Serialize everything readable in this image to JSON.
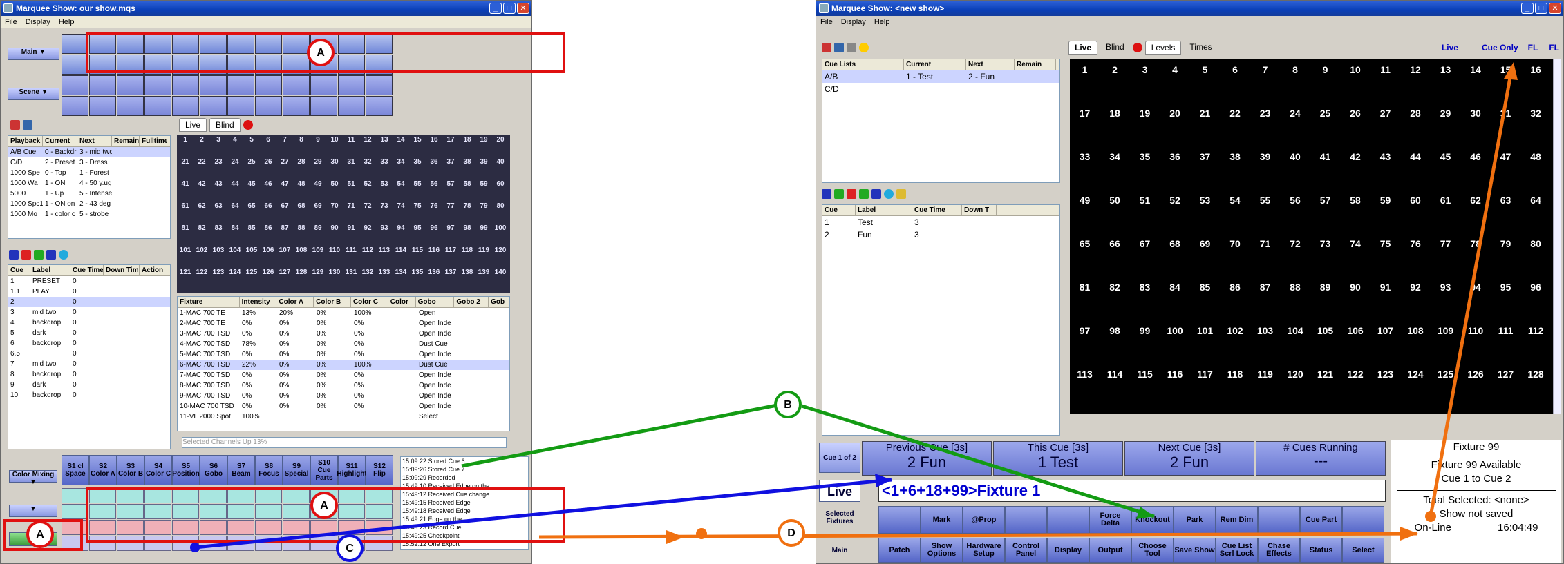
{
  "left": {
    "title": "Marquee Show: our show.mqs",
    "menu": [
      "File",
      "Display",
      "Help"
    ],
    "main_label": "Main",
    "scene_label": "Scene",
    "cue_lists_hdr": [
      "Playback",
      "Current",
      "Next",
      "Remain",
      "Fulltime"
    ],
    "cue_lists": [
      [
        "A/B Cue",
        "0 - Backdrop",
        "3 - mid two",
        "",
        ""
      ],
      [
        "C/D",
        "2 - Preset",
        "3 - Dress",
        "",
        ""
      ],
      [
        "1000 Spe",
        "0 - Top",
        "1 - Forest",
        "",
        ""
      ],
      [
        "1000 Wa",
        "1 - ON",
        "4 - 50 y.ug",
        "",
        ""
      ],
      [
        "5000",
        "1 - Up",
        "5 - Intense",
        "",
        ""
      ],
      [
        "1000 Spc1",
        "1 - ON on",
        "2 - 43 deg",
        "",
        ""
      ],
      [
        "1000 Mo",
        "1 - color c",
        "5 - strobe",
        "",
        ""
      ]
    ],
    "cues_hdr": [
      "Cue",
      "Label",
      "Cue Time",
      "Down Time",
      "Action"
    ],
    "cues": [
      [
        "1",
        "PRESET",
        "0"
      ],
      [
        "1.1",
        "PLAY",
        "0"
      ],
      [
        "2",
        "",
        "0"
      ],
      [
        "3",
        "mid two",
        "0"
      ],
      [
        "4",
        "backdrop",
        "0"
      ],
      [
        "5",
        "dark",
        "0"
      ],
      [
        "6",
        "backdrop",
        "0"
      ],
      [
        "6.5",
        "",
        "0"
      ],
      [
        "7",
        "mid two",
        "0"
      ],
      [
        "8",
        "backdrop",
        "0"
      ],
      [
        "9",
        "dark",
        "0"
      ],
      [
        "10",
        "backdrop",
        "0"
      ]
    ],
    "tabs": [
      "Live",
      "Blind"
    ],
    "fixtures_hdr": [
      "Fixture",
      "Intensity",
      "Color A",
      "Color B",
      "Color C",
      "Color",
      "Gobo",
      "Gobo 2",
      "Gob"
    ],
    "fixtures": [
      [
        "1-MAC 700 TE",
        "13%",
        "20%",
        "0%",
        "100%",
        "",
        "Open"
      ],
      [
        "2-MAC 700 TE",
        "0%",
        "0%",
        "0%",
        "0%",
        "",
        "Open Inde"
      ],
      [
        "3-MAC 700 TSD",
        "0%",
        "0%",
        "0%",
        "0%",
        "",
        "Open Inde"
      ],
      [
        "4-MAC 700 TSD",
        "78%",
        "0%",
        "0%",
        "0%",
        "",
        "Dust Cue"
      ],
      [
        "5-MAC 700 TSD",
        "0%",
        "0%",
        "0%",
        "0%",
        "",
        "Open Inde"
      ],
      [
        "6-MAC 700 TSD",
        "22%",
        "0%",
        "0%",
        "100%",
        "",
        "Dust Cue"
      ],
      [
        "7-MAC 700 TSD",
        "0%",
        "0%",
        "0%",
        "0%",
        "",
        "Open Inde"
      ],
      [
        "8-MAC 700 TSD",
        "0%",
        "0%",
        "0%",
        "0%",
        "",
        "Open Inde"
      ],
      [
        "9-MAC 700 TSD",
        "0%",
        "0%",
        "0%",
        "0%",
        "",
        "Open Inde"
      ],
      [
        "10-MAC 700 TSD",
        "0%",
        "0%",
        "0%",
        "0%",
        "",
        "Open Inde"
      ],
      [
        "11-VL 2000 Spot",
        "100%",
        "",
        "",
        "",
        "",
        "Select"
      ]
    ],
    "status_line": "Selected Channels Up 13%",
    "sbtn_row": [
      "S1 cl Space",
      "S2 Color A",
      "S3 Color B",
      "S4 Color C",
      "S5 Position",
      "S6 Gobo",
      "S7 Beam",
      "S8 Focus",
      "S9 Special",
      "S10 Cue Parts",
      "S11 Highlight",
      "S12 Flip"
    ],
    "color_mixing": "Color Mixing",
    "messages": [
      "15:09:22 Stored Cue 6",
      "15:09:26 Stored Cue 7",
      "15:09:29 Recorded",
      "15:49:10 Received Edge on the",
      "15:49:12 Received Cue change",
      "15:49:15 Received Edge",
      "15:49:18 Received Edge",
      "15:49:21 Edge on the",
      "15:49:23 Record Cue",
      "15:49:25 Checkpoint",
      "15:52:12 One Export"
    ]
  },
  "right": {
    "title": "Marquee Show: <new show>",
    "menu": [
      "File",
      "Display",
      "Help"
    ],
    "cue_lists_hdr": [
      "Cue Lists",
      "Current",
      "Next",
      "Remain"
    ],
    "cue_lists": [
      [
        "A/B",
        "1 - Test",
        "2 - Fun"
      ],
      [
        "C/D",
        "",
        ""
      ]
    ],
    "cues_hdr": [
      "Cue",
      "Label",
      "Cue Time",
      "Down T"
    ],
    "cues": [
      [
        "1",
        "Test",
        "3"
      ],
      [
        "2",
        "Fun",
        "3"
      ]
    ],
    "tabs": {
      "live": "Live",
      "blind": "Blind",
      "levels": "Levels",
      "times": "Times"
    },
    "hdr_right": [
      "Live",
      "Cue Only",
      "FL",
      "FL"
    ],
    "cue_counter": "Cue 1 of 2",
    "prev_cue": {
      "label": "Previous Cue [3s]",
      "value": "2 Fun"
    },
    "this_cue": {
      "label": "This Cue [3s]",
      "value": "1 Test"
    },
    "next_cue": {
      "label": "Next Cue [3s]",
      "value": "2 Fun"
    },
    "cues_running": {
      "label": "# Cues Running",
      "value": "---"
    },
    "live_label": "Live",
    "command": "<1+6+18+99>Fixture 1",
    "selected_fixtures_label": "Selected Fixtures",
    "main_label": "Main",
    "row1": [
      "",
      "Mark",
      "@Prop",
      "",
      "",
      "Force Delta",
      "Knockout",
      "Park",
      "Rem Dim",
      "",
      "Cue Part",
      ""
    ],
    "row2": [
      "Patch",
      "Show Options",
      "Hardware Setup",
      "Control Panel",
      "Display",
      "Output",
      "Choose Tool",
      "Save Show",
      "Cue List Scrl Lock",
      "Chase Effects",
      "Status",
      "Select"
    ],
    "fixture_panel": {
      "title": "Fixture 99",
      "line1": "Fixture 99 Available",
      "line2": "Cue 1 to Cue 2",
      "selected": "Total Selected: <none>",
      "saved": "Show not saved",
      "online": "On-Line",
      "time": "16:04:49"
    }
  },
  "annotations": [
    "A",
    "A",
    "A",
    "B",
    "C",
    "D"
  ],
  "colors": {
    "annot_red": "#e01010",
    "annot_green": "#139b13",
    "annot_blue": "#1010e0",
    "annot_orange": "#f07010"
  }
}
